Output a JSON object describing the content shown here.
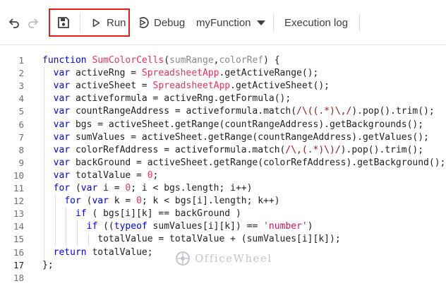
{
  "toolbar": {
    "run_label": "Run",
    "debug_label": "Debug",
    "function_selected": "myFunction",
    "execution_log_label": "Execution log"
  },
  "code": {
    "line_numbers": [
      "1",
      "2",
      "3",
      "4",
      "5",
      "6",
      "7",
      "8",
      "9",
      "10",
      "11",
      "12",
      "13",
      "14",
      "15",
      "16",
      "17",
      "18"
    ],
    "active_line": 17,
    "lines": [
      [
        {
          "t": "function",
          "c": "kw"
        },
        {
          "t": " "
        },
        {
          "t": "SumColorCells",
          "c": "fn"
        },
        {
          "t": "("
        },
        {
          "t": "sumRange",
          "c": "ar"
        },
        {
          "t": ","
        },
        {
          "t": "colorRef",
          "c": "ar"
        },
        {
          "t": ") {"
        }
      ],
      [
        {
          "t": "  "
        },
        {
          "t": "var",
          "c": "kw"
        },
        {
          "t": " activeRng = "
        },
        {
          "t": "SpreadsheetApp",
          "c": "fn"
        },
        {
          "t": ".getActiveRange();"
        }
      ],
      [
        {
          "t": "  "
        },
        {
          "t": "var",
          "c": "kw"
        },
        {
          "t": " activeSheet = "
        },
        {
          "t": "SpreadsheetApp",
          "c": "fn"
        },
        {
          "t": ".getActiveSheet();"
        }
      ],
      [
        {
          "t": "  "
        },
        {
          "t": "var",
          "c": "kw"
        },
        {
          "t": " activeformula = activeRng.getFormula();"
        }
      ],
      [
        {
          "t": "  "
        },
        {
          "t": "var",
          "c": "kw"
        },
        {
          "t": " countRangeAddress = activeformula.match("
        },
        {
          "t": "/\\((.*)\\,/",
          "c": "rx"
        },
        {
          "t": ").pop().trim();"
        }
      ],
      [
        {
          "t": "  "
        },
        {
          "t": "var",
          "c": "kw"
        },
        {
          "t": " bgs = activeSheet.getRange(countRangeAddress).getBackgrounds();"
        }
      ],
      [
        {
          "t": "  "
        },
        {
          "t": "var",
          "c": "kw"
        },
        {
          "t": " sumValues = activeSheet.getRange(countRangeAddress).getValues();"
        }
      ],
      [
        {
          "t": "  "
        },
        {
          "t": "var",
          "c": "kw"
        },
        {
          "t": " colorRefAddress = activeformula.match("
        },
        {
          "t": "/\\,(.*)\\)/",
          "c": "rx"
        },
        {
          "t": ").pop().trim();"
        }
      ],
      [
        {
          "t": "  "
        },
        {
          "t": "var",
          "c": "kw"
        },
        {
          "t": " backGround = activeSheet.getRange(colorRefAddress).getBackground();"
        }
      ],
      [
        {
          "t": "  "
        },
        {
          "t": "var",
          "c": "kw"
        },
        {
          "t": " totalValue = "
        },
        {
          "t": "0",
          "c": "fn"
        },
        {
          "t": ";"
        }
      ],
      [
        {
          "t": "  "
        },
        {
          "t": "for",
          "c": "kw"
        },
        {
          "t": " ("
        },
        {
          "t": "var",
          "c": "kw"
        },
        {
          "t": " i = "
        },
        {
          "t": "0",
          "c": "fn"
        },
        {
          "t": "; i < bgs.length; i++)"
        }
      ],
      [
        {
          "t": "    "
        },
        {
          "t": "for",
          "c": "kw"
        },
        {
          "t": " ("
        },
        {
          "t": "var",
          "c": "kw"
        },
        {
          "t": " k = "
        },
        {
          "t": "0",
          "c": "fn"
        },
        {
          "t": "; k < bgs[i].length; k++)"
        }
      ],
      [
        {
          "t": "      "
        },
        {
          "t": "if",
          "c": "kw"
        },
        {
          "t": " ( bgs[i][k] == backGround )"
        }
      ],
      [
        {
          "t": "        "
        },
        {
          "t": "if",
          "c": "kw"
        },
        {
          "t": " (("
        },
        {
          "t": "typeof",
          "c": "kw"
        },
        {
          "t": " sumValues[i][k]) == "
        },
        {
          "t": "'number'",
          "c": "st"
        },
        {
          "t": ")"
        }
      ],
      [
        {
          "t": "          totalValue = totalValue + (sumValues[i][k]);"
        }
      ],
      [
        {
          "t": "  "
        },
        {
          "t": "return",
          "c": "kw"
        },
        {
          "t": " totalValue;"
        }
      ],
      [
        {
          "t": "};"
        }
      ],
      []
    ]
  },
  "watermark": {
    "text": "OfficeWheel"
  },
  "colors": {
    "highlight": "#e0201b",
    "keyword": "#0000ff",
    "function_name": "#e8335e",
    "argument": "#8a8a8a",
    "regex": "#a31515",
    "string": "#c2185b"
  }
}
